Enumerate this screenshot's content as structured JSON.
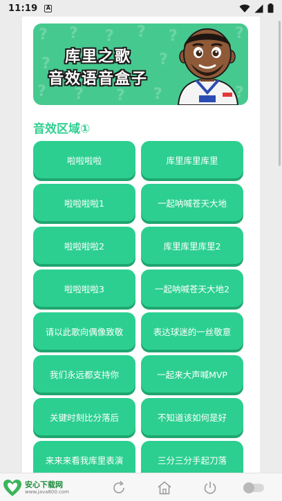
{
  "status_bar": {
    "time": "11:19",
    "notification_glyph": "A"
  },
  "banner": {
    "line1": "库里之歌",
    "line2": "音效语音盒子",
    "bg_color": "#46c98f"
  },
  "section": {
    "title": "音效区域①"
  },
  "sounds": [
    "啦啦啦啦",
    "库里库里库里",
    "啦啦啦啦1",
    "一起呐喊苍天大地",
    "啦啦啦啦2",
    "库里库里库里2",
    "啦啦啦啦3",
    "一起呐喊苍天大地2",
    "请以此歌向偶像致敬",
    "表达球迷的一丝敬意",
    "我们永远都支持你",
    "一起来大声喊MVP",
    "关键时刻比分落后",
    "不知道该如何是好",
    "来来来看我库里表演",
    "三分三分手起刀落"
  ],
  "colors": {
    "accent": "#2ccf90",
    "accent_shadow": "#1fa66f"
  },
  "watermark": {
    "name": "安心下载网",
    "url": "www.java800.com"
  },
  "nav_icons": [
    "refresh-icon",
    "home-icon",
    "power-icon",
    "toggle-icon"
  ]
}
